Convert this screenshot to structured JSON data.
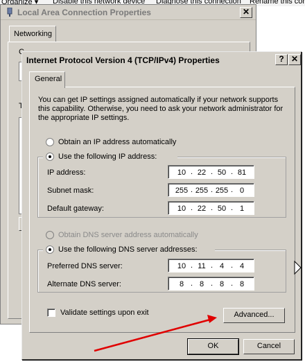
{
  "toolbar": {
    "organize": "Organize ▾",
    "disable": "Disable this network device",
    "diagnose": "Diagnose this connection",
    "rename": "Rename this connection"
  },
  "back_window": {
    "title": "Local Area Connection Properties",
    "tab": "Networking",
    "close": "✕",
    "frag_c": "C",
    "frag_t": "T"
  },
  "dialog": {
    "title": "Internet Protocol Version 4 (TCP/IPv4) Properties",
    "help_btn": "?",
    "close_btn": "✕",
    "tab": "General",
    "intro": "You can get IP settings assigned automatically if your network supports this capability. Otherwise, you need to ask your network administrator for the appropriate IP settings.",
    "ip_auto_label": "Obtain an IP address automatically",
    "ip_manual_label": "Use the following IP address:",
    "ip_address_label": "IP address:",
    "ip_address": [
      "10",
      "22",
      "50",
      "81"
    ],
    "subnet_label": "Subnet mask:",
    "subnet": [
      "255",
      "255",
      "255",
      "0"
    ],
    "gateway_label": "Default gateway:",
    "gateway": [
      "10",
      "22",
      "50",
      "1"
    ],
    "dns_auto_label": "Obtain DNS server address automatically",
    "dns_manual_label": "Use the following DNS server addresses:",
    "dns_pref_label": "Preferred DNS server:",
    "dns_pref": [
      "10",
      "11",
      "4",
      "4"
    ],
    "dns_alt_label": "Alternate DNS server:",
    "dns_alt": [
      "8",
      "8",
      "8",
      "8"
    ],
    "validate_label": "Validate settings upon exit",
    "advanced_btn": "Advanced...",
    "ok_btn": "OK",
    "cancel_btn": "Cancel",
    "ip_mode": "manual",
    "dns_mode": "manual",
    "validate_checked": false
  },
  "colors": {
    "dialog_bg": "#d4d0c8",
    "annotation_arrow": "#e00000"
  }
}
